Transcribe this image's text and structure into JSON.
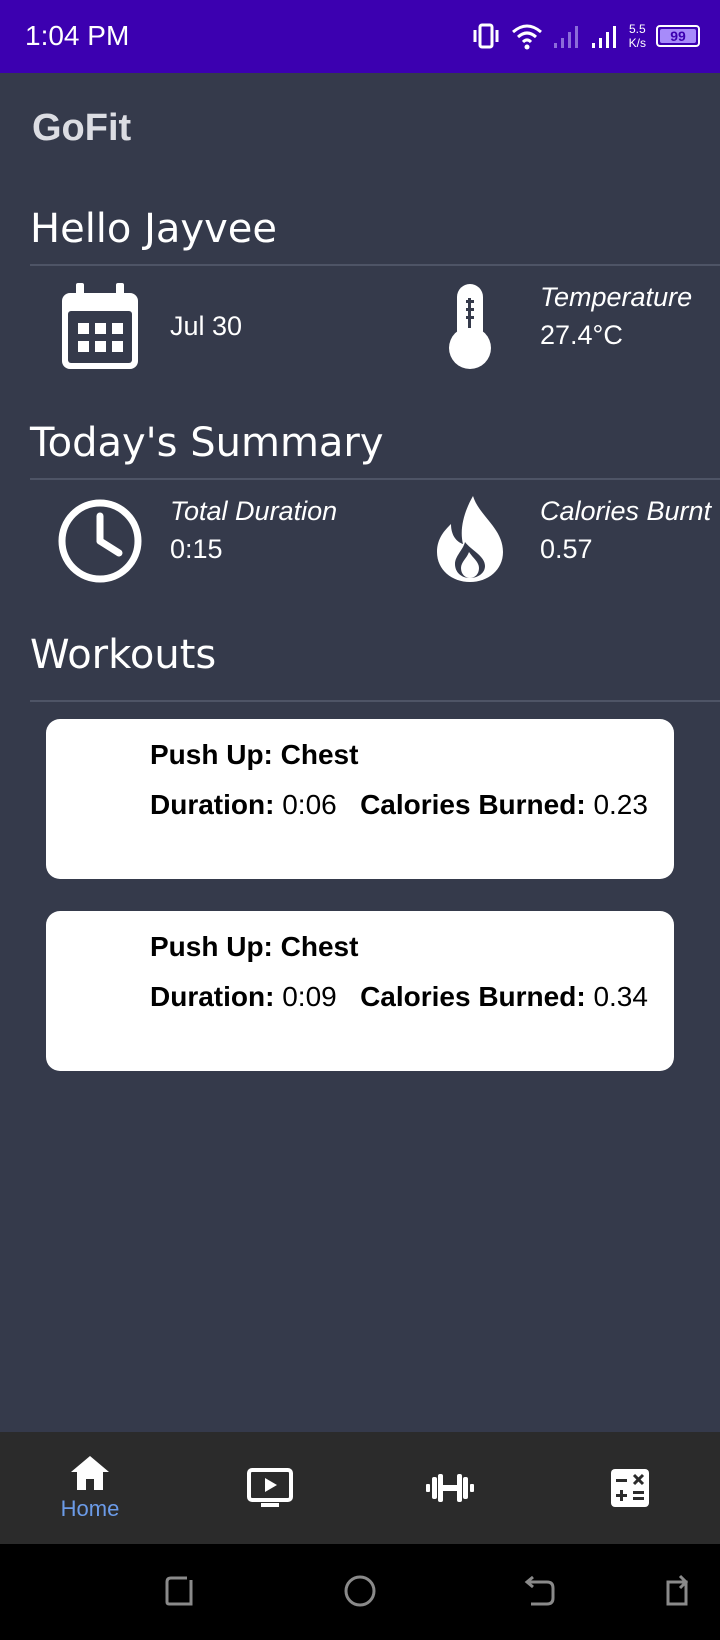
{
  "status_bar": {
    "time": "1:04 PM",
    "speed_value": "5.5",
    "speed_unit": "K/s",
    "battery": "99"
  },
  "app": {
    "title": "GoFit"
  },
  "greeting": {
    "title": "Hello Jayvee"
  },
  "info": {
    "date": "Jul 30",
    "temperature_label": "Temperature",
    "temperature_value": "27.4°C"
  },
  "summary": {
    "title": "Today's Summary",
    "duration_label": "Total Duration",
    "duration_value": "0:15",
    "calories_label": "Calories Burnt",
    "calories_value": "0.57"
  },
  "workouts": {
    "title": "Workouts",
    "items": [
      {
        "title": "Push Up: Chest",
        "duration_label": "Duration:",
        "duration": "0:06",
        "calories_label": "Calories Burned:",
        "calories": "0.23"
      },
      {
        "title": "Push Up: Chest",
        "duration_label": "Duration:",
        "duration": "0:09",
        "calories_label": "Calories Burned:",
        "calories": "0.34"
      }
    ]
  },
  "bottom_nav": {
    "home_label": "Home",
    "items": [
      "home-icon",
      "video-icon",
      "dumbbell-icon",
      "calculator-icon"
    ]
  },
  "colors": {
    "background": "#353a4b",
    "status_bar": "#3c00b0",
    "nav_active": "#6b9be8",
    "nav_bar": "#2b2b2b"
  }
}
